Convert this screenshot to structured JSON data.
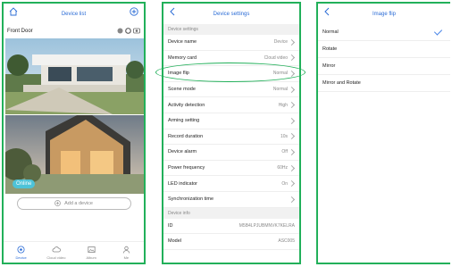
{
  "phone1": {
    "title": "Device list",
    "device_name": "Front Door",
    "badge": "Online",
    "add_button": "Add a device",
    "tabs": [
      {
        "label": "Device",
        "icon": "device-icon",
        "active": true
      },
      {
        "label": "Cloud video",
        "icon": "cloud-icon",
        "active": false
      },
      {
        "label": "Album",
        "icon": "album-icon",
        "active": false
      },
      {
        "label": "Me",
        "icon": "person-icon",
        "active": false
      }
    ]
  },
  "phone2": {
    "title": "Device settings",
    "section1": "Device settings",
    "rows": [
      {
        "label": "Device name",
        "value": "Device"
      },
      {
        "label": "Memory card",
        "value": "Cloud video"
      },
      {
        "label": "Image flip",
        "value": "Normal"
      },
      {
        "label": "Scene mode",
        "value": "Normal"
      },
      {
        "label": "Activity detection",
        "value": "High"
      },
      {
        "label": "Arming setting",
        "value": ""
      },
      {
        "label": "Record duration",
        "value": "10s"
      },
      {
        "label": "Device alarm",
        "value": "Off"
      },
      {
        "label": "Power frequency",
        "value": "60Hz"
      },
      {
        "label": "LED indicator",
        "value": "On"
      },
      {
        "label": "Synchronization time",
        "value": ""
      }
    ],
    "section2": "Device info",
    "info_rows": [
      {
        "label": "ID",
        "value": "M5B4LPJUBMNVK7KELRA"
      },
      {
        "label": "Model",
        "value": "ASC005"
      }
    ]
  },
  "phone3": {
    "title": "Image flip",
    "options": [
      {
        "label": "Normal",
        "selected": true
      },
      {
        "label": "Rotate",
        "selected": false
      },
      {
        "label": "Mirror",
        "selected": false
      },
      {
        "label": "Mirror and Rotate",
        "selected": false
      }
    ]
  },
  "colors": {
    "accent": "#2b6cd6",
    "frame": "#22b05a",
    "online": "#4ec3d8"
  }
}
